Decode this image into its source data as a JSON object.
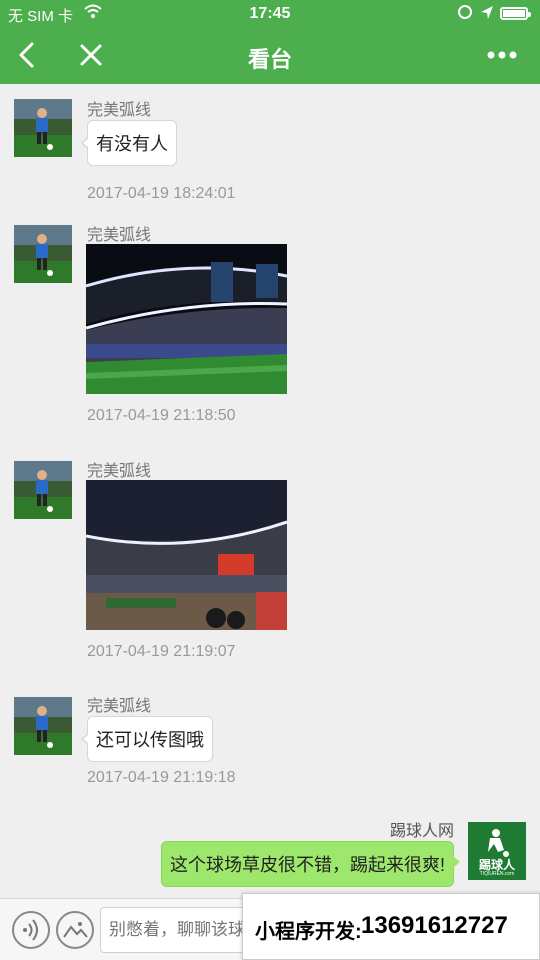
{
  "status_bar": {
    "carrier": "无 SIM 卡",
    "time": "17:45"
  },
  "nav": {
    "title": "看台"
  },
  "messages": [
    {
      "sender": "完美弧线",
      "text": "有没有人",
      "time": "2017-04-19 18:24:01"
    },
    {
      "sender": "完美弧线",
      "time": "2017-04-19 21:18:50"
    },
    {
      "sender": "完美弧线",
      "time": "2017-04-19 21:19:07"
    },
    {
      "sender": "完美弧线",
      "text": "还可以传图哦",
      "time": "2017-04-19 21:19:18"
    }
  ],
  "my_message": {
    "sender": "踢球人网",
    "text": "这个球场草皮很不错，踢起来很爽!"
  },
  "my_avatar": {
    "title": "踢球人",
    "subtitle": "TIQIUREN.com"
  },
  "input": {
    "placeholder": "别憋着，聊聊该球"
  },
  "promo": {
    "label": "小程序开发:",
    "phone": "13691612727"
  },
  "colors": {
    "accent": "#4cae4c",
    "my_bubble": "#9de86c"
  }
}
